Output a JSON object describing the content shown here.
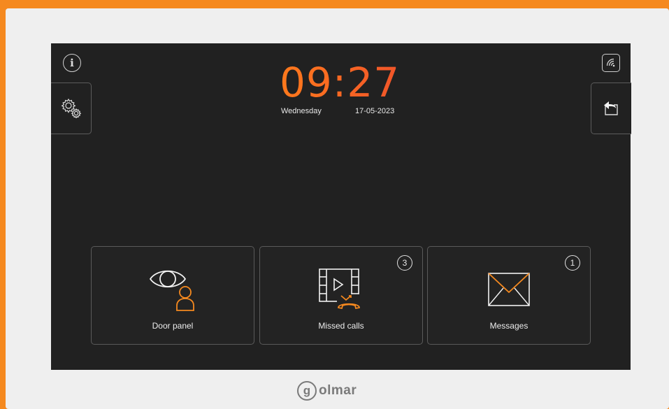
{
  "time": "09:27",
  "day": "Wednesday",
  "date": "17-05-2023",
  "tiles": [
    {
      "label": "Door panel",
      "badge": null
    },
    {
      "label": "Missed calls",
      "badge": "3"
    },
    {
      "label": "Messages",
      "badge": "1"
    }
  ],
  "brand": {
    "mark": "g",
    "word": "olmar"
  },
  "colors": {
    "accent": "#f5891f",
    "clock_start": "#ff7a1c",
    "clock_end": "#f0532a",
    "screen_bg": "#212121"
  },
  "icons": {
    "info": "info-icon",
    "wifi": "wireless-icon",
    "settings": "gears-icon",
    "back": "back-arrow-icon"
  }
}
